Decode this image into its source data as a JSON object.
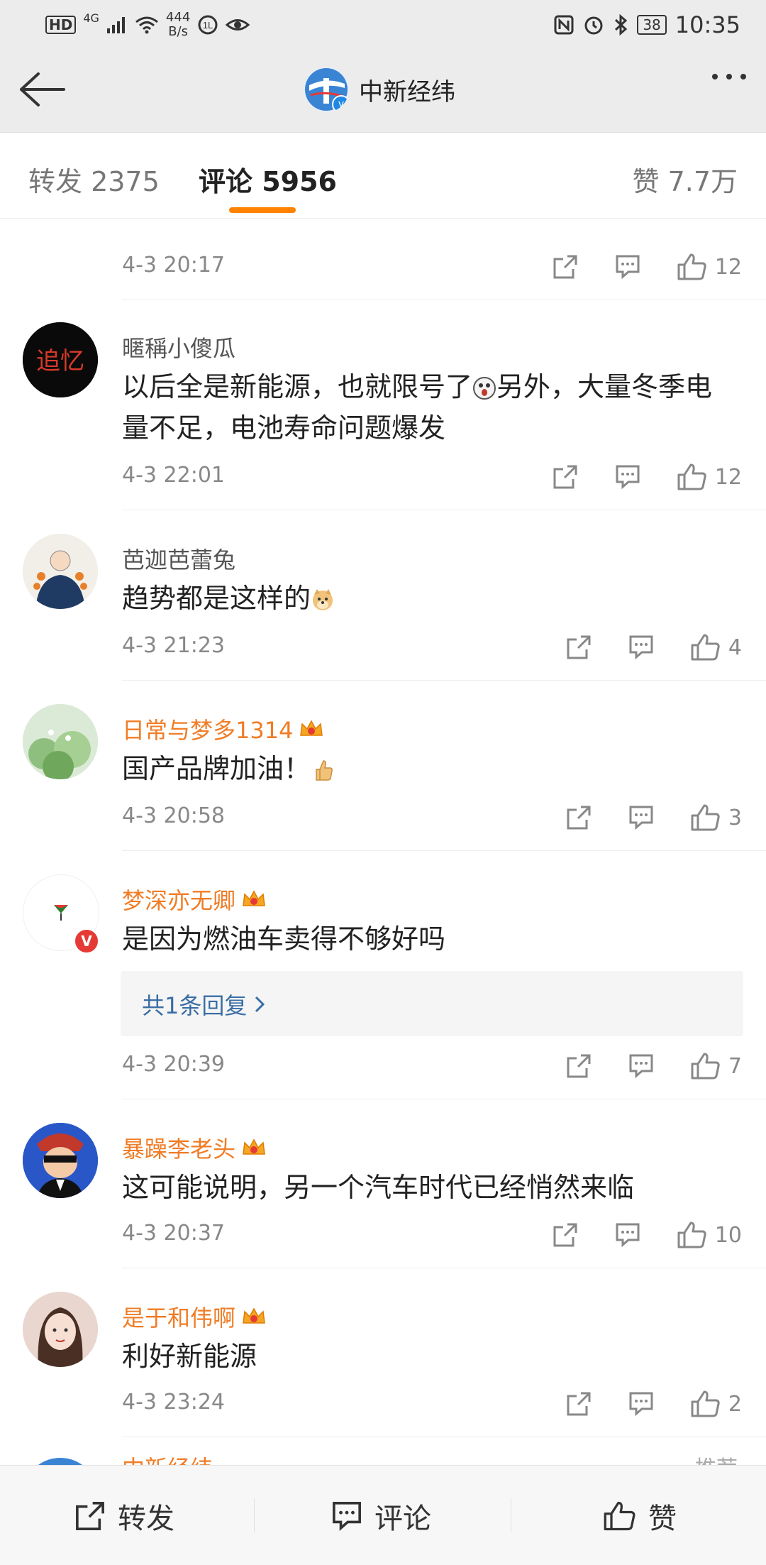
{
  "status_bar": {
    "hd": "HD",
    "signal": "4G",
    "net_rate_value": "444",
    "net_rate_unit": "B/s",
    "battery": "38",
    "time": "10:35"
  },
  "header": {
    "title": "中新经纬"
  },
  "tabs": {
    "repost": "转发 2375",
    "comments": "评论 5956",
    "likes": "赞 7.7万"
  },
  "top_partial": {
    "timestamp": "4-3 20:17",
    "like_count": "12"
  },
  "comments": [
    {
      "username": "暱稱小傻瓜",
      "vip": false,
      "text_1": "以后全是新能源，也就限号了",
      "text_2": "另外，大量冬季电量不足，电池寿命问题爆发",
      "timestamp": "4-3 22:01",
      "like_count": "12"
    },
    {
      "username": "芭迦芭蕾兔",
      "vip": false,
      "text_1": "趋势都是这样的",
      "timestamp": "4-3 21:23",
      "like_count": "4"
    },
    {
      "username": "日常与梦多1314",
      "vip": true,
      "text_1": "国产品牌加油！",
      "timestamp": "4-3 20:58",
      "like_count": "3"
    },
    {
      "username": "梦深亦无卿",
      "vip": true,
      "text_1": "是因为燃油车卖得不够好吗",
      "reply_link": "共1条回复",
      "timestamp": "4-3 20:39",
      "like_count": "7"
    },
    {
      "username": "暴躁李老头",
      "vip": true,
      "text_1": "这可能说明，另一个汽车时代已经悄然来临",
      "timestamp": "4-3 20:37",
      "like_count": "10"
    },
    {
      "username": "是于和伟啊",
      "vip": true,
      "text_1": "利好新能源",
      "timestamp": "4-3 23:24",
      "like_count": "2"
    }
  ],
  "partial_bottom": {
    "username": "中新经纬",
    "right_label": "推荐"
  },
  "bottom_bar": {
    "repost": "转发",
    "comment": "评论",
    "like": "赞"
  },
  "colors": {
    "accent": "#ff8200",
    "vip_name": "#f07c25",
    "link": "#3a6ea5"
  }
}
